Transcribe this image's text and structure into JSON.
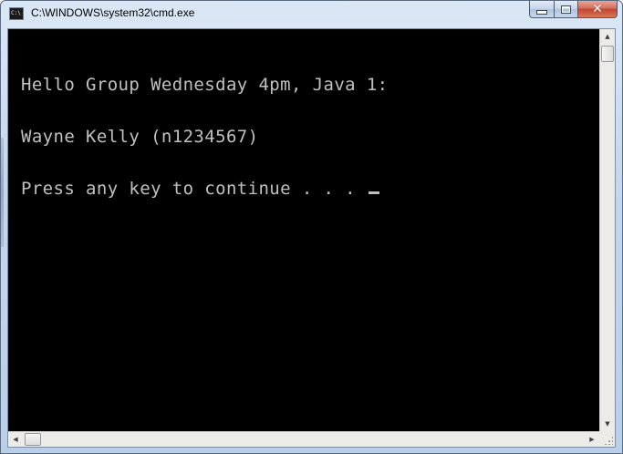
{
  "window": {
    "title": "C:\\WINDOWS\\system32\\cmd.exe",
    "icon_label": "C:\\",
    "icon_name": "cmd-icon"
  },
  "caption_buttons": {
    "minimize_icon": "minimize-icon",
    "maximize_icon": "maximize-icon",
    "close_icon": "close-icon",
    "close_glyph": "✕"
  },
  "console": {
    "lines": [
      "Hello Group Wednesday 4pm, Java 1:",
      "Wayne Kelly (n1234567)",
      "Press any key to continue . . . "
    ],
    "background_color": "#000000",
    "text_color": "#c0c0c0"
  },
  "scrollbars": {
    "up_arrow": "▲",
    "down_arrow": "▼",
    "left_arrow": "◀",
    "right_arrow": "▶"
  }
}
